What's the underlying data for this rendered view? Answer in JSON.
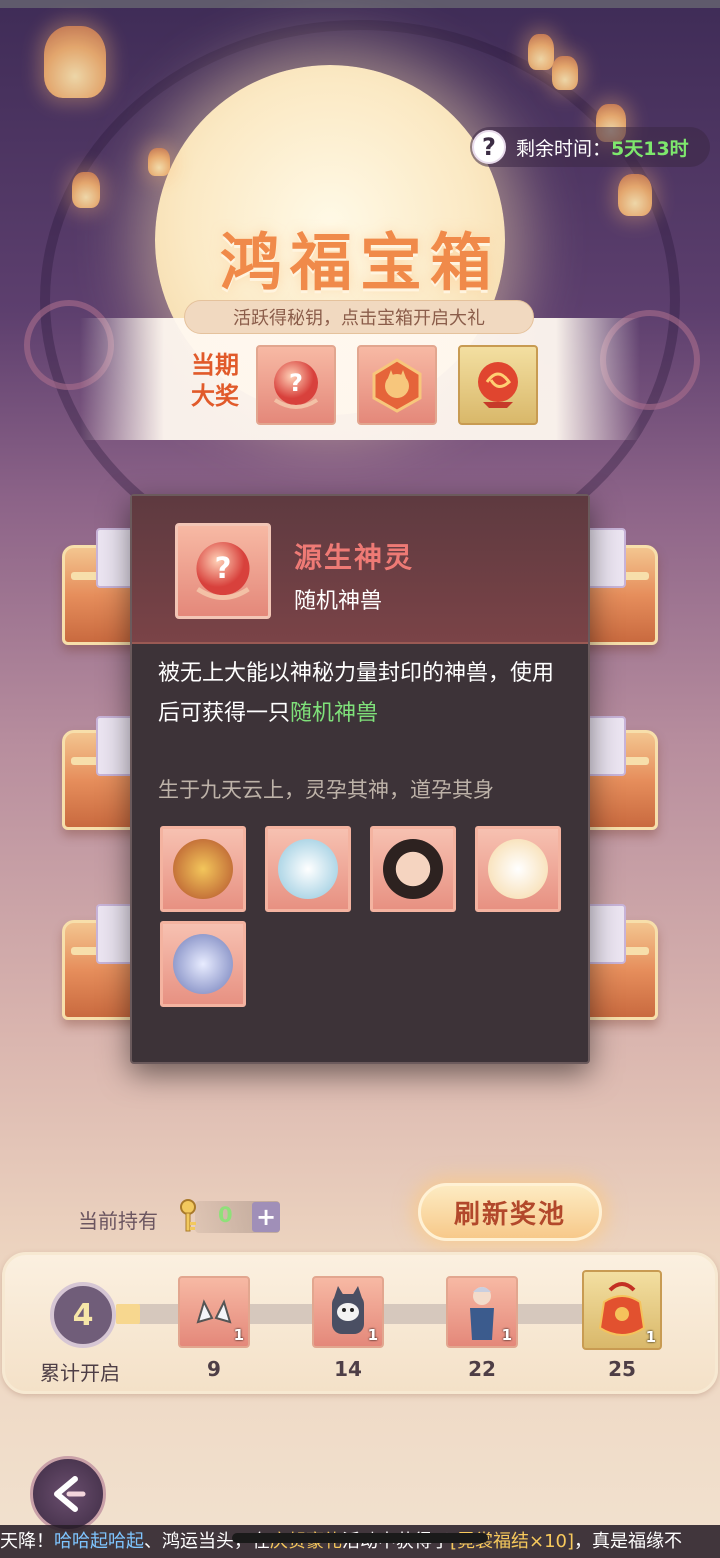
{
  "header": {
    "timer_label": "剩余时间：",
    "timer_value": "5天13时",
    "help_icon_glyph": "?"
  },
  "title": "鸿福宝箱",
  "subtitle": "活跃得秘钥，点击宝箱开启大礼",
  "prizes": {
    "label_line1": "当期",
    "label_line2": "大奖",
    "items": [
      {
        "icon": "mystery-orb-icon",
        "glyph": "?"
      },
      {
        "icon": "cat-gem-icon"
      },
      {
        "icon": "fire-orb-icon"
      }
    ]
  },
  "popup": {
    "name": "源生神灵",
    "type": "随机神兽",
    "desc_part1": "被无上大能以神秘力量封印的神兽，使用后可获得一只",
    "desc_highlight": "随机神兽",
    "flavor": "生于九天云上，灵孕其神，道孕其身",
    "beasts": [
      {
        "name": "golden-dragon-beast",
        "color": "#e2a43a"
      },
      {
        "name": "white-dragon-beast",
        "color": "#9fd3e6"
      },
      {
        "name": "warrior-portrait",
        "color": "#4a3532"
      },
      {
        "name": "white-cat-beast",
        "color": "#fff2e6"
      },
      {
        "name": "silver-fox-portrait",
        "color": "#c6cbe6"
      }
    ]
  },
  "holdings": {
    "label": "当前持有",
    "count": "0",
    "plus": "+"
  },
  "refresh_button": "刷新奖池",
  "progress": {
    "current": "4",
    "label": "累计开启",
    "fill_fraction": 0.05,
    "milestones": [
      {
        "value": "9",
        "qty": "1",
        "icon": "cat-ears-icon"
      },
      {
        "value": "14",
        "qty": "1",
        "icon": "husky-backpack-icon"
      },
      {
        "value": "22",
        "qty": "1",
        "icon": "character-outfit-icon"
      },
      {
        "value": "25",
        "qty": "1",
        "icon": "lucky-pouch-icon"
      }
    ]
  },
  "ticker": {
    "part1": "天降！",
    "name": "哈哈起哈起",
    "part2": "、鸿运当头，在",
    "event": "庆贺豪礼",
    "part3": "活动中获得了",
    "reward": "[霓裳福结×10]",
    "part4": "，真是福缘不"
  },
  "colors": {
    "timer_green": "#7ee86d",
    "title_orange": "#f08a4a",
    "highlight_green": "#7fe17a",
    "popup_name_red": "#ee7a75"
  }
}
